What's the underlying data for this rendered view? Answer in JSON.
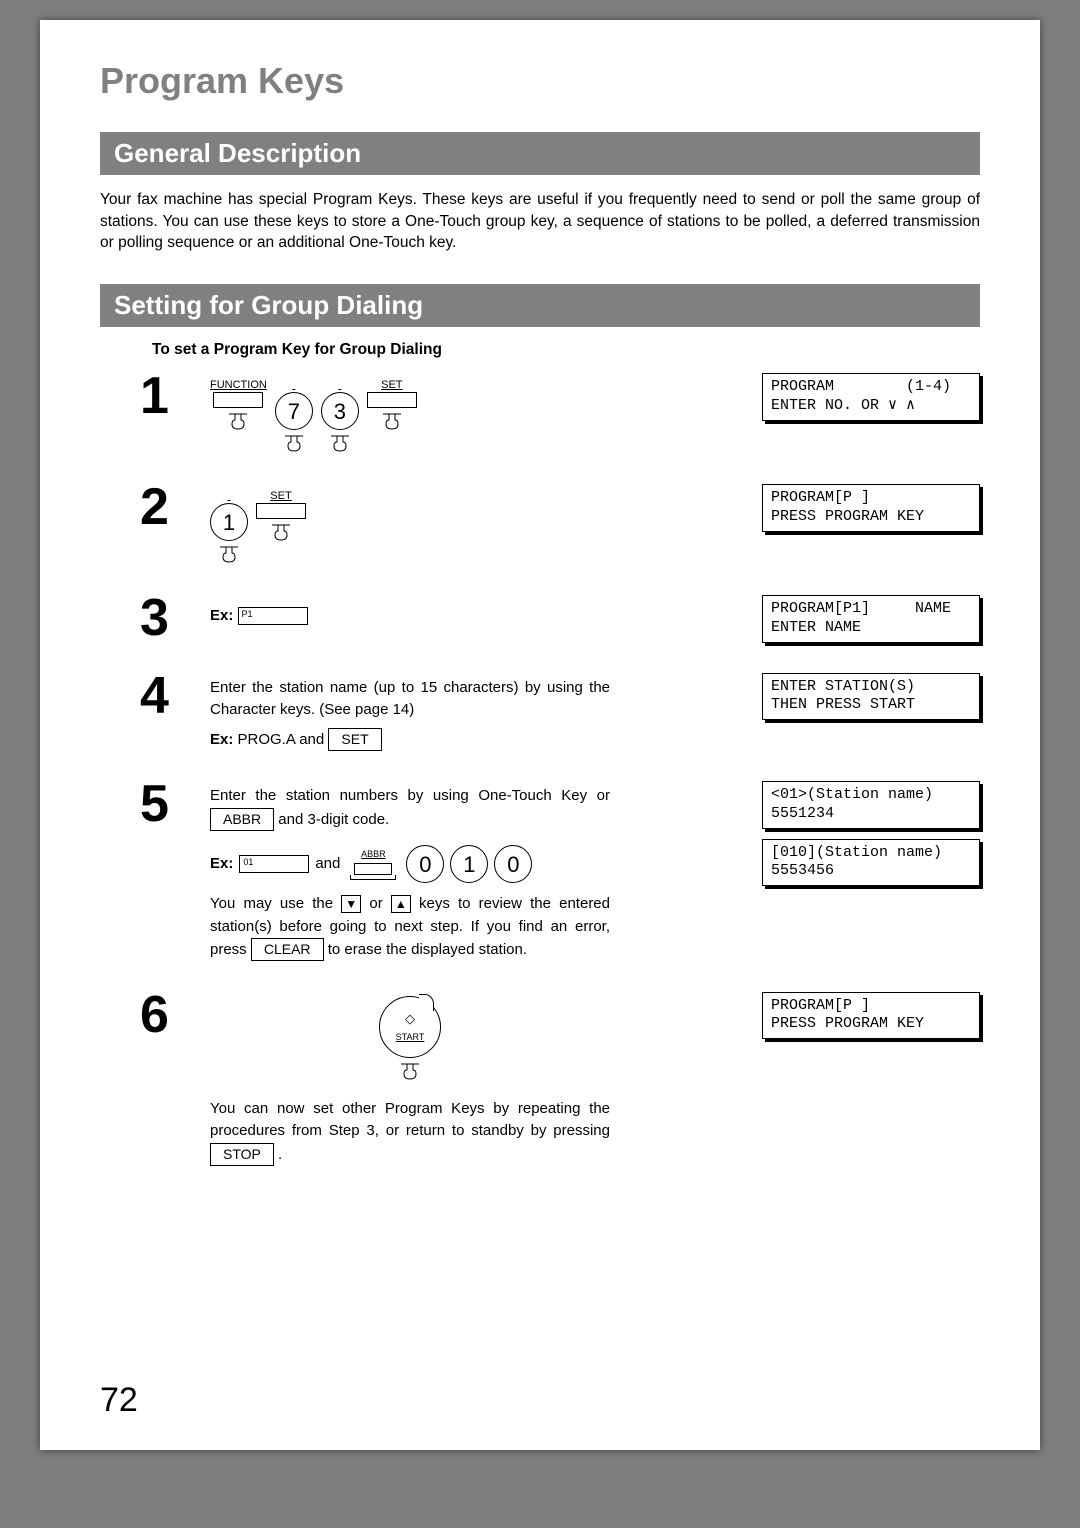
{
  "title": "Program Keys",
  "page_number": "72",
  "section1": {
    "heading": "General Description",
    "body": "Your fax machine has special Program Keys.  These keys are useful if you frequently need to send or poll the same group of stations.  You can use these keys to store a One-Touch group key, a sequence of stations to be polled, a deferred transmission or polling sequence or an additional One-Touch key."
  },
  "section2": {
    "heading": "Setting for Group Dialing",
    "subhead": "To set a Program Key for Group Dialing"
  },
  "labels": {
    "function": "FUNCTION",
    "set": "SET",
    "abbr": "ABBR",
    "clear": "CLEAR",
    "stop": "STOP",
    "start": "START",
    "ex": "Ex:"
  },
  "step1": {
    "num": "1",
    "k1": "7",
    "k2": "3",
    "lcd": "PROGRAM        (1-4)\nENTER NO. OR ∨ ∧"
  },
  "step2": {
    "num": "2",
    "k1": "1",
    "lcd": "PROGRAM[P ]\nPRESS PROGRAM KEY"
  },
  "step3": {
    "num": "3",
    "field": "P1",
    "lcd": "PROGRAM[P1]     NAME\nENTER NAME"
  },
  "step4": {
    "num": "4",
    "line1": "Enter the station name (up to 15 characters) by using the Character keys.  (See page 14)",
    "ex_pre": "Ex: ",
    "ex_val": "PROG.A and ",
    "set_key": "SET",
    "lcd": "ENTER STATION(S)\nTHEN PRESS START"
  },
  "step5": {
    "num": "5",
    "line1a": "Enter the station numbers by using One-Touch Key or ",
    "abbr_key": "ABBR",
    "line1b": " and 3-digit code.",
    "ex_field": "01",
    "and": " and ",
    "d0": "0",
    "d1": "1",
    "d2": "0",
    "line2a": "You may use the ",
    "line2b": " or ",
    "line2c": " keys to review the entered station(s) before going to next step. If you find an error, press ",
    "line2d": " to erase the displayed station.",
    "lcd1": "<01>(Station name)\n5551234",
    "lcd2": "[010](Station name)\n5553456"
  },
  "step6": {
    "num": "6",
    "line1": "You can now set other Program Keys by repeating the procedures from Step 3, or return to standby by pressing ",
    "stop_key": "STOP",
    "period": " .",
    "lcd": "PROGRAM[P ]\nPRESS PROGRAM KEY"
  }
}
